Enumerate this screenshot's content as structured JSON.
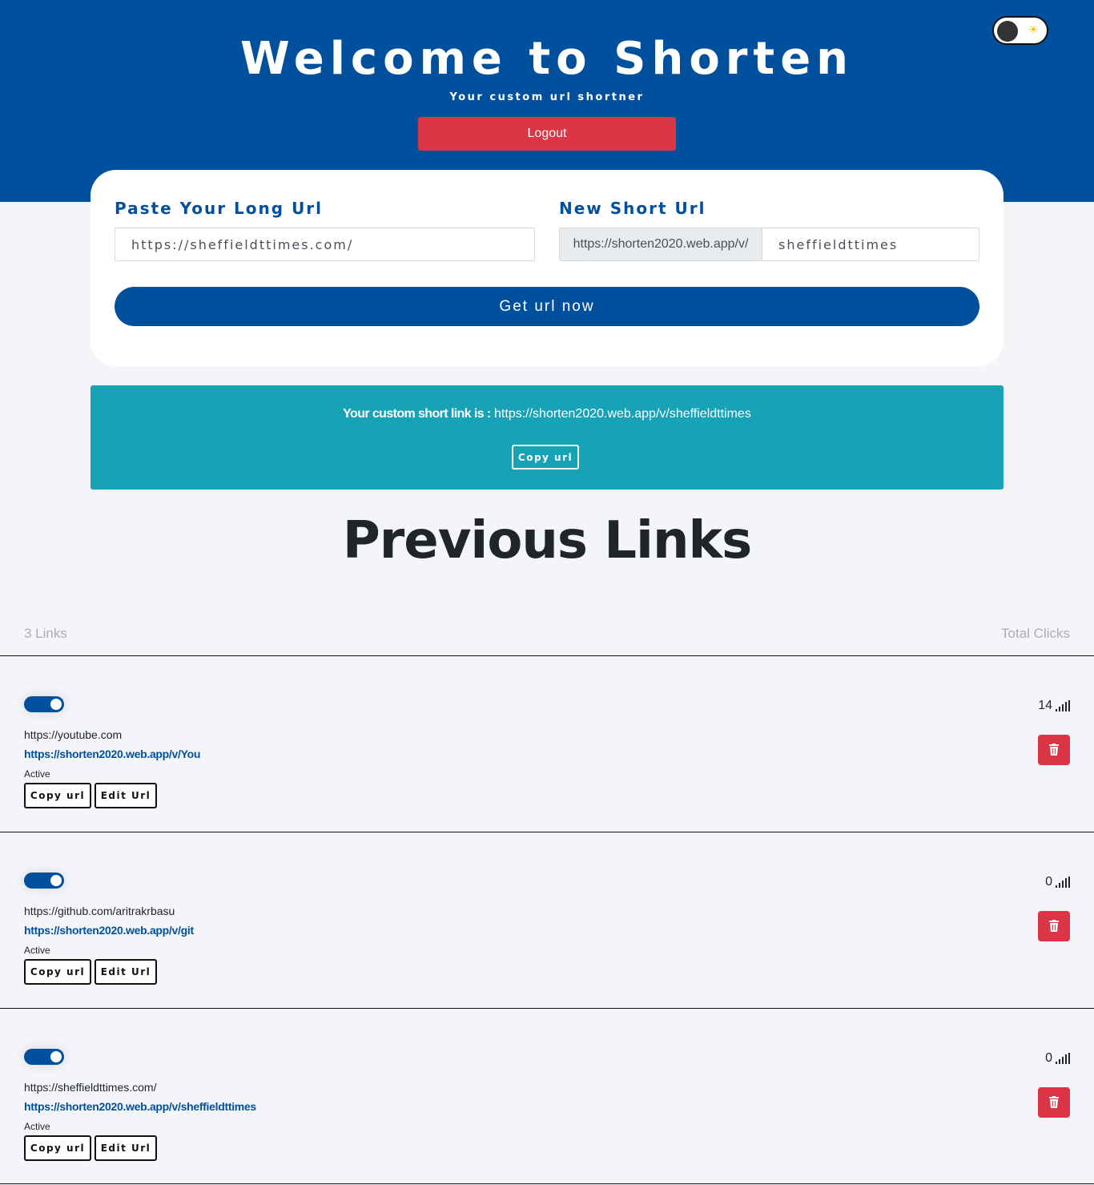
{
  "header": {
    "title": "Welcome to Shorten",
    "subtitle": "Your custom url shortner",
    "logout_label": "Logout",
    "theme_icon": "sun-icon"
  },
  "form": {
    "long_label": "Paste Your Long Url",
    "long_value": "https://sheffieldttimes.com/",
    "short_label": "New Short Url",
    "short_prefix": "https://shorten2020.web.app/v/",
    "short_value": "sheffieldttimes",
    "submit_label": "Get url now"
  },
  "result": {
    "label": "Your custom short link is :",
    "url": "https://shorten2020.web.app/v/sheffieldttimes",
    "copy_label": "Copy url"
  },
  "previous": {
    "title": "Previous Links",
    "count_label": "3 Links",
    "clicks_label": "Total Clicks",
    "links": [
      {
        "long_url": "https://youtube.com",
        "short_url": "https://shorten2020.web.app/v/You",
        "status": "Active",
        "clicks": "14",
        "enabled": true,
        "copy_label": "Copy url",
        "edit_label": "Edit Url"
      },
      {
        "long_url": "https://github.com/aritrakrbasu",
        "short_url": "https://shorten2020.web.app/v/git",
        "status": "Active",
        "clicks": "0",
        "enabled": true,
        "copy_label": "Copy url",
        "edit_label": "Edit Url"
      },
      {
        "long_url": "https://sheffieldttimes.com/",
        "short_url": "https://shorten2020.web.app/v/sheffieldttimes",
        "status": "Active",
        "clicks": "0",
        "enabled": true,
        "copy_label": "Copy url",
        "edit_label": "Edit Url"
      }
    ]
  },
  "colors": {
    "primary": "#01509d",
    "danger": "#dc3545",
    "info": "#17a2b8",
    "background": "#f4f5f8"
  }
}
